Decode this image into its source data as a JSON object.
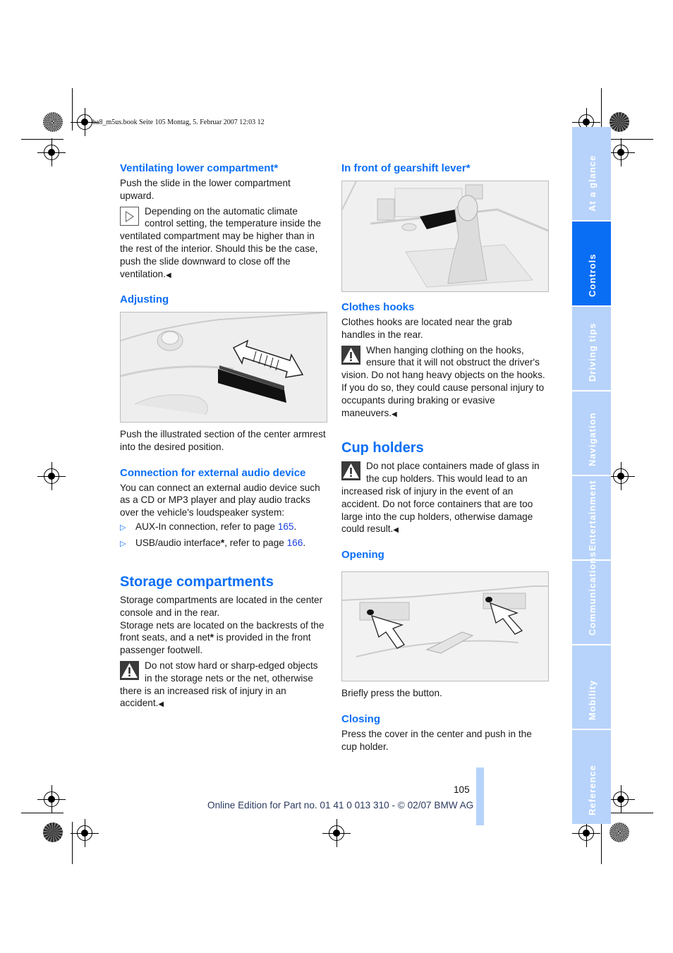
{
  "header": {
    "print_line": "ba8_m5us.book  Seite 105  Montag, 5. Februar 2007  12:03 12"
  },
  "left_column": {
    "ventilating": {
      "heading": "Ventilating lower compartment*",
      "body": "Push the slide in the lower compartment upward.",
      "note_icon": "info-triangle-icon",
      "note": "Depending on the automatic climate control setting, the temperature inside the ventilated compartment may be higher than in the rest of the interior. Should this be the case, push the slide downward to close off the ventilation."
    },
    "adjusting": {
      "heading": "Adjusting",
      "illustration": "center-armrest-slide-illustration",
      "caption": "Push the illustrated section of the center armrest into the desired position."
    },
    "audio": {
      "heading": "Connection for external audio device",
      "body": "You can connect an external audio device such as a CD or MP3 player and play audio tracks over the vehicle's loudspeaker system:",
      "bullets": [
        {
          "text": "AUX-In connection, refer to page ",
          "page": "165"
        },
        {
          "text": "USB/audio interface",
          "star": "*",
          "text2": ", refer to page ",
          "page": "166"
        }
      ]
    },
    "storage": {
      "heading": "Storage compartments",
      "body1": "Storage compartments are located in the center console and in the rear.",
      "body2_a": "Storage nets are located on the backrests of the front seats, and a net",
      "body2_star": "*",
      "body2_b": " is provided in the front passenger footwell.",
      "warning": "Do not stow hard or sharp-edged objects in the storage nets or the net, otherwise there is an increased risk of injury in an accident."
    }
  },
  "right_column": {
    "gearshift": {
      "heading": "In front of gearshift lever*",
      "illustration": "gearshift-compartment-illustration"
    },
    "clothes_hooks": {
      "heading": "Clothes hooks",
      "body": "Clothes hooks are located near the grab handles in the rear.",
      "warning": "When hanging clothing on the hooks, ensure that it will not obstruct the driver's vision. Do not hang heavy objects on the hooks. If you do so, they could cause personal injury to occupants during braking or evasive maneuvers."
    },
    "cup_holders": {
      "heading": "Cup holders",
      "warning": "Do not place containers made of glass in the cup holders. This would lead to an increased risk of injury in the event of an accident. Do not force containers that are too large into the cup holders, otherwise damage could result."
    },
    "opening": {
      "heading": "Opening",
      "illustration": "cup-holder-buttons-illustration",
      "body": "Briefly press the button."
    },
    "closing": {
      "heading": "Closing",
      "body": "Press the cover in the center and push in the cup holder."
    }
  },
  "end_mark": "◀",
  "sidebar": {
    "tabs": [
      {
        "label": "At a glance",
        "active": false
      },
      {
        "label": "Controls",
        "active": true
      },
      {
        "label": "Driving tips",
        "active": false
      },
      {
        "label": "Navigation",
        "active": false
      },
      {
        "label": "Entertainment",
        "active": false
      },
      {
        "label": "Communications",
        "active": false
      },
      {
        "label": "Mobility",
        "active": false
      },
      {
        "label": "Reference",
        "active": false
      }
    ]
  },
  "footer": {
    "page_number": "105",
    "edition": "Online Edition for Part no. 01 41 0 013 310 - © 02/07 BMW AG"
  },
  "colors": {
    "heading_blue": "#0a6ef5",
    "tab_light": "#b7d3fb",
    "tab_active": "#0a6ef5",
    "link_blue": "#1a3fe0"
  }
}
